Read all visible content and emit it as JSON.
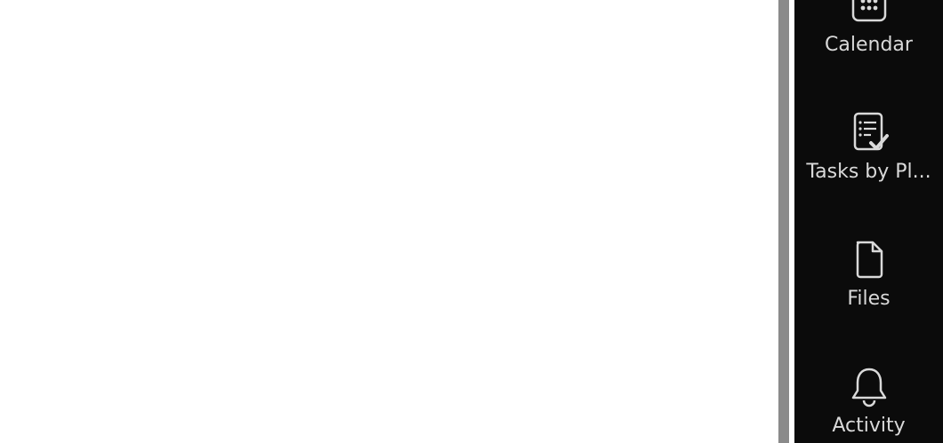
{
  "rail": {
    "items": [
      {
        "label": "Calendar",
        "icon": "calendar-icon"
      },
      {
        "label": "Tasks by Pl...",
        "icon": "tasks-icon"
      },
      {
        "label": "Files",
        "icon": "file-icon"
      },
      {
        "label": "Activity",
        "icon": "bell-icon"
      }
    ]
  },
  "colors": {
    "rail_background": "#0b0b0b",
    "rail_foreground": "#d9d9d9",
    "scrollbar": "#8a8a8a",
    "content_background": "#ffffff"
  }
}
